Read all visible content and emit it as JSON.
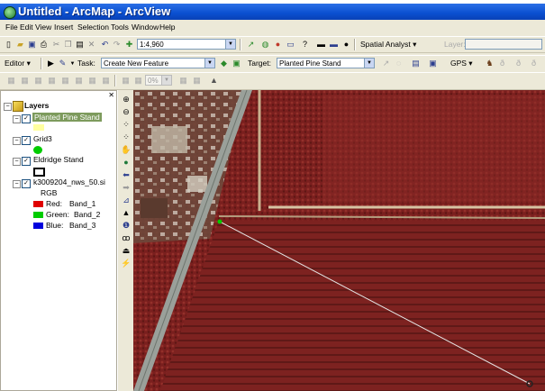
{
  "window": {
    "title": "Untitled - ArcMap - ArcView"
  },
  "menubar": {
    "items": [
      "File",
      "Edit",
      "View",
      "Insert",
      "Selection",
      "Tools",
      "Window",
      "Help"
    ]
  },
  "standard_toolbar": {
    "scale": "1:4,960",
    "spatial_analyst_label": "Spatial Analyst ▾",
    "layer_label": "Layer:"
  },
  "editor_toolbar": {
    "editor_label": "Editor ▾",
    "task_label": "Task:",
    "task_value": "Create New Feature",
    "target_label": "Target:",
    "target_value": "Planted Pine Stand",
    "gps_label": "GPS ▾"
  },
  "raster_toolbar": {
    "value": "0%"
  },
  "toc": {
    "root": "Layers",
    "layers": [
      {
        "name": "Planted Pine Stand",
        "selected": true,
        "symbol_color": "#ffffa0"
      },
      {
        "name": "Grid3",
        "symbol_color": "#00cc00"
      },
      {
        "name": "Eldridge Stand",
        "symbol_color": "#000000"
      },
      {
        "name": "k3009204_nws_50.si",
        "band_type": "RGB",
        "bands": [
          {
            "label": "Red:",
            "band": "Band_1",
            "color": "#e00000"
          },
          {
            "label": "Green:",
            "band": "Band_2",
            "color": "#00cc00"
          },
          {
            "label": "Blue:",
            "band": "Band_3",
            "color": "#0000dd"
          }
        ]
      }
    ]
  },
  "colors": {
    "accent": "#0A4FD0",
    "selection": "#316AC5",
    "map_red": "#7a1f1e"
  }
}
